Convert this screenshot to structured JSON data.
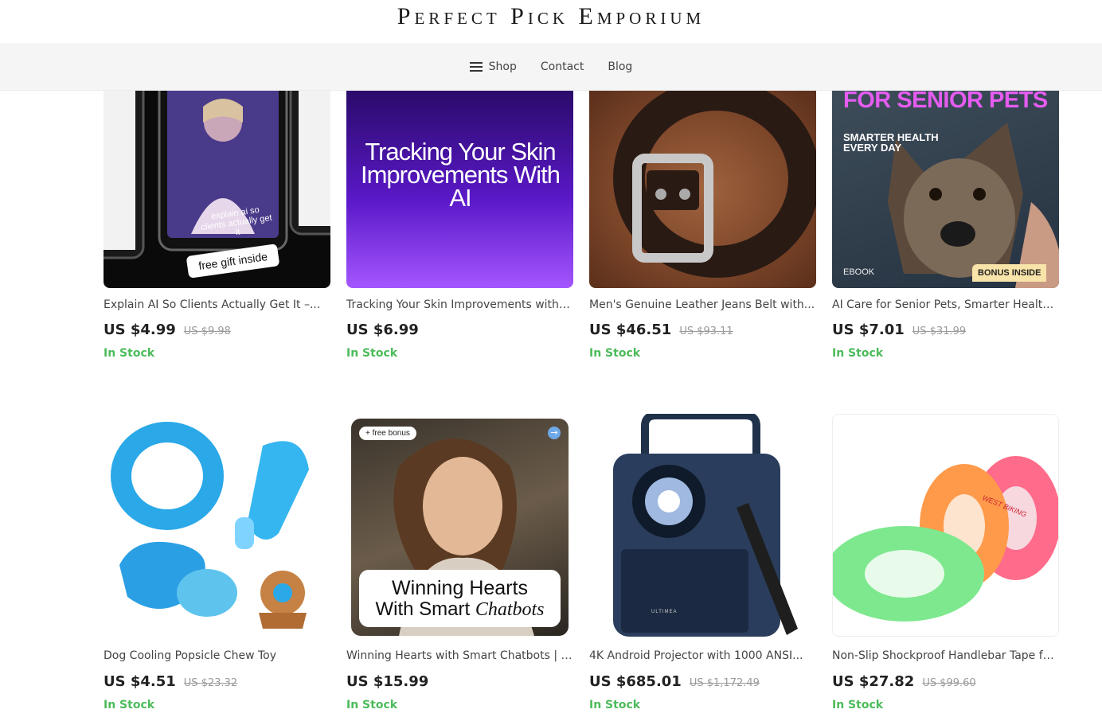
{
  "site": {
    "title": "Perfect Pick Emporium"
  },
  "nav": {
    "items": [
      {
        "label": "Shop",
        "icon": "hamburger-menu-icon"
      },
      {
        "label": "Contact"
      },
      {
        "label": "Blog"
      }
    ]
  },
  "products": [
    {
      "title": "Explain AI So Clients Actually Get It –...",
      "price": "US $4.99",
      "compare_price": "US $9.98",
      "stock": "In Stock",
      "image": {
        "screen_text": "explain ai so clients actually get it",
        "sticker": "free gift inside"
      }
    },
    {
      "title": "Tracking Your Skin Improvements with AI...",
      "price": "US $6.99",
      "compare_price": "",
      "stock": "In Stock",
      "image": {
        "headline": "Tracking Your Skin Improvements With AI"
      }
    },
    {
      "title": "Men's Genuine Leather Jeans Belt with...",
      "price": "US $46.51",
      "compare_price": "US $93.11",
      "stock": "In Stock",
      "image": {}
    },
    {
      "title": "AI Care for Senior Pets, Smarter Health...",
      "price": "US $7.01",
      "compare_price": "US $31.99",
      "stock": "In Stock",
      "image": {
        "headline": "FOR SENIOR PETS",
        "subhead": "SMARTER HEALTH EVERY DAY",
        "tag_left": "EBOOK",
        "tag_right": "BONUS INSIDE"
      }
    },
    {
      "title": "Dog Cooling Popsicle Chew Toy",
      "price": "US $4.51",
      "compare_price": "US $23.32",
      "stock": "In Stock",
      "image": {}
    },
    {
      "title": "Winning Hearts with Smart Chatbots | A...",
      "price": "US $15.99",
      "compare_price": "",
      "stock": "In Stock",
      "image": {
        "badge": "+ free bonus",
        "line1": "Winning Hearts",
        "line2a": "With Smart ",
        "line2b": "Chatbots"
      }
    },
    {
      "title": "4K Android Projector with 1000 ANSI...",
      "price": "US $685.01",
      "compare_price": "US $1,172.49",
      "stock": "In Stock",
      "image": {
        "brand": "ULTIMEA"
      }
    },
    {
      "title": "Non-Slip Shockproof Handlebar Tape for...",
      "price": "US $27.82",
      "compare_price": "US $99.60",
      "stock": "In Stock",
      "image": {
        "tape_print": "WEST BIKING"
      }
    }
  ],
  "colors": {
    "in_stock": "#4cbb5b",
    "nav_bg": "#f5f5f5"
  }
}
